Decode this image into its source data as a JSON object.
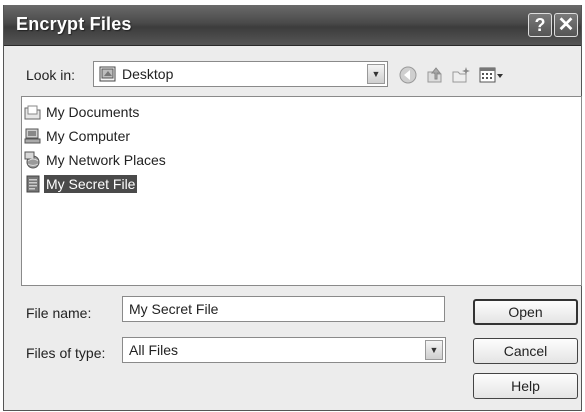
{
  "window": {
    "title": "Encrypt Files",
    "help_glyph": "?",
    "close_glyph": "✕"
  },
  "lookin": {
    "label": "Look in:",
    "value": "Desktop",
    "icon": "desktop-icon"
  },
  "toolbar": {
    "icons": [
      "back-icon",
      "up-folder-icon",
      "new-folder-icon",
      "view-menu-icon"
    ]
  },
  "files": [
    {
      "label": "My Documents",
      "icon": "documents-folder-icon",
      "selected": false
    },
    {
      "label": "My Computer",
      "icon": "computer-icon",
      "selected": false
    },
    {
      "label": "My Network Places",
      "icon": "network-places-icon",
      "selected": false
    },
    {
      "label": "My Secret File",
      "icon": "file-icon",
      "selected": true
    }
  ],
  "filename": {
    "label": "File name:",
    "value": "My Secret File"
  },
  "filetype": {
    "label": "Files of type:",
    "value": "All Files"
  },
  "buttons": {
    "open": "Open",
    "cancel": "Cancel",
    "help": "Help"
  }
}
